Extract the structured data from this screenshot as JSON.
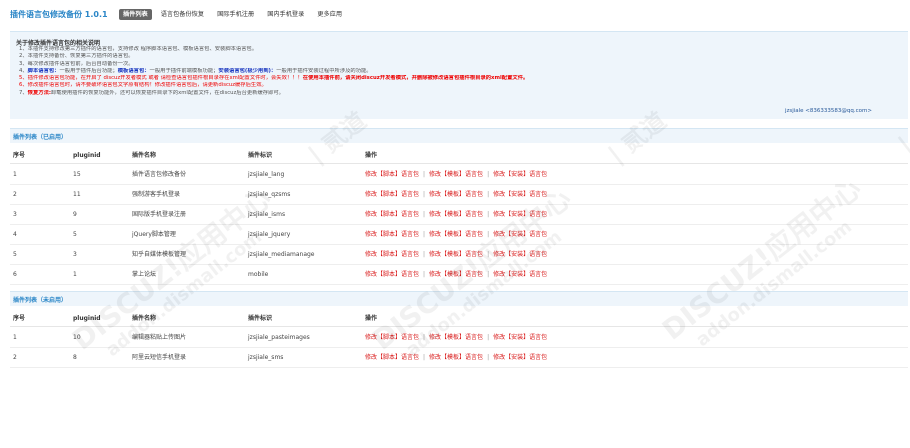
{
  "app": {
    "title": "插件语言包修改备份 1.0.1"
  },
  "tabs": [
    {
      "label": "插件列表",
      "active": true
    },
    {
      "label": "语言包备份恢复",
      "active": false
    },
    {
      "label": "国际手机注册",
      "active": false
    },
    {
      "label": "国内手机登录",
      "active": false
    },
    {
      "label": "更多应用",
      "active": false
    }
  ],
  "notice": {
    "title": "关于修改插件语言包的相关说明",
    "line1": "1、本插件支持修改第三方插件的语言包，支持修改 程序脚本语言包、模板语言包、安装脚本语言包。",
    "line2": "2、本插件支持备份、恢复第三方插件的语言包。",
    "line3": "3、每次修改插件语言包前，后台自动备份一次。",
    "line4_prefix": "4、",
    "line4_term1": "脚本语言包：",
    "line4_text1": "一般用于插件后台功能；",
    "line4_term2": "模板语言包：",
    "line4_text2": "一般用于插件前端模板功能；",
    "line4_term3": "安装语言包(极少用到)：",
    "line4_text3": "一般用于插件安装过程中所涉及的功能。",
    "line5_a": "5、插件修改语言包功能，在开启了 discuz开发者模式 或者 请检查语言包插件根目录存在xml配置文件时，会失效！！！",
    "line5_b": "在使用本插件前，请关闭discuz开发者模式，并删除被修改语言包插件根目录的xml配置文件。",
    "line6_a": "6、修改插件语言包时，请不要破坏语言包文字原有结构！修改插件语言包后，请更新discuz缓存后生效。",
    "line7_prefix": "7、",
    "line7_term": "恢复方法:",
    "line7_text": "卸载使用插件的恢复功能外，还可以恢复插件目录下的xml配置文件，在discuz后台更新缓存即可。",
    "contact": "jzsjiale <836333583@qq.com>"
  },
  "columns": {
    "col1": "序号",
    "col2": "pluginid",
    "col3": "插件名称",
    "col4": "插件标识",
    "col5": "操作"
  },
  "ops": {
    "script": "修改【脚本】语言包",
    "template": "修改【模板】语言包",
    "install": "修改【安装】语言包",
    "sep": "|"
  },
  "enabled_section": {
    "title": "插件列表（已启用）",
    "rows": [
      {
        "no": "1",
        "pluginid": "15",
        "name": "插件语言包修改备份",
        "ident": "jzsjiale_lang"
      },
      {
        "no": "2",
        "pluginid": "11",
        "name": "强制游客手机登录",
        "ident": "jzsjiale_qzsms"
      },
      {
        "no": "3",
        "pluginid": "9",
        "name": "国际版手机登录注册",
        "ident": "jzsjiale_isms"
      },
      {
        "no": "4",
        "pluginid": "5",
        "name": "jQuery脚本管理",
        "ident": "jzsjiale_jquery"
      },
      {
        "no": "5",
        "pluginid": "3",
        "name": "知乎自媒体模板管理",
        "ident": "jzsjiale_mediamanage"
      },
      {
        "no": "6",
        "pluginid": "1",
        "name": "掌上论坛",
        "ident": "mobile"
      }
    ]
  },
  "disabled_section": {
    "title": "插件列表（未启用）",
    "rows": [
      {
        "no": "1",
        "pluginid": "10",
        "name": "编辑器粘贴上传图片",
        "ident": "jzsjiale_pasteimages"
      },
      {
        "no": "2",
        "pluginid": "8",
        "name": "阿里云短信手机登录",
        "ident": "jzsjiale_sms"
      }
    ]
  },
  "watermark": {
    "brand": "DISCUZ!应用中心",
    "domain": "addon.dismall.com",
    "sub": "| 贰道"
  }
}
